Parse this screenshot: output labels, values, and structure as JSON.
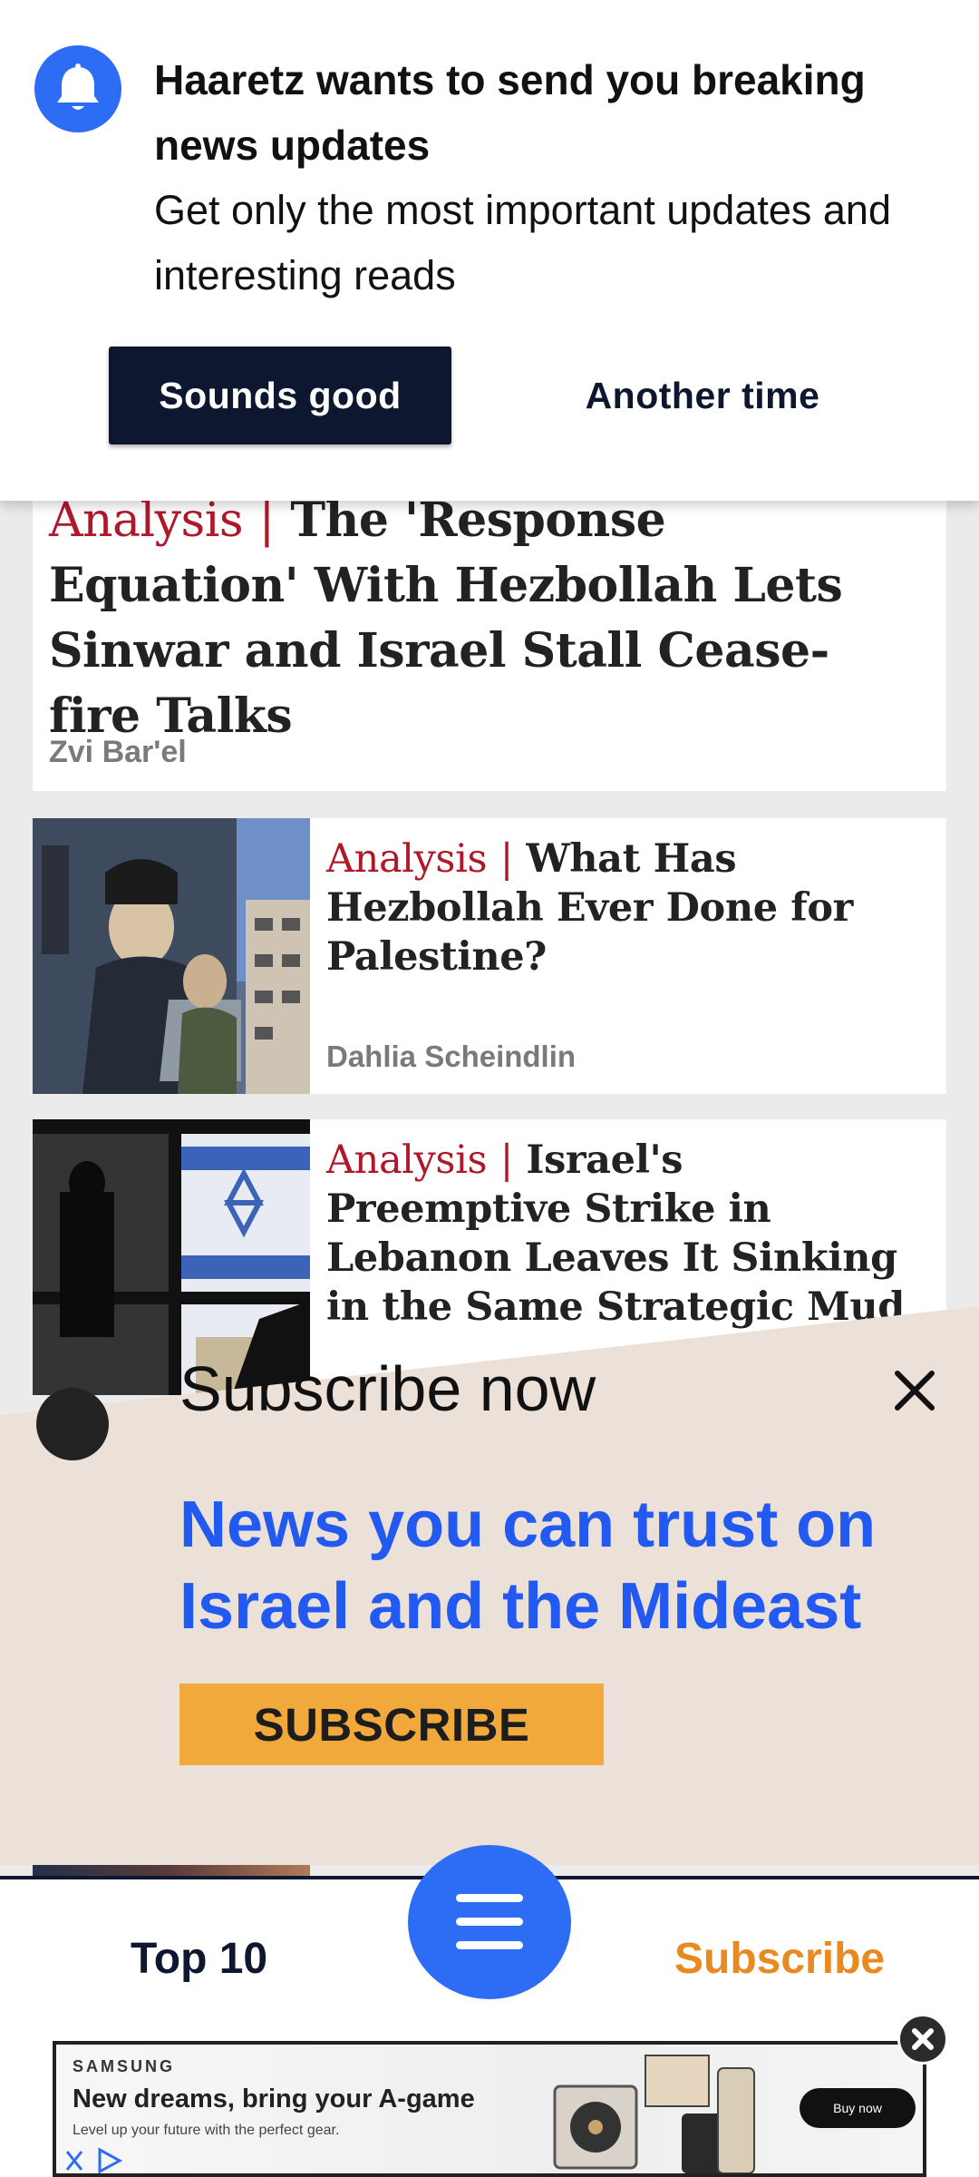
{
  "notification_prompt": {
    "title": "Haaretz wants to send you breaking news updates",
    "body": "Get only the most important updates and interesting reads",
    "accept_label": "Sounds good",
    "dismiss_label": "Another time",
    "icon": "bell-icon",
    "accent_color": "#2d6cf4"
  },
  "feed": {
    "articles": [
      {
        "kicker": "Analysis",
        "separator": "|",
        "title": "The 'Response Equation' With Hezbollah Lets Sinwar and Israel Stall Cease-fire Talks",
        "author": "Zvi Bar'el"
      },
      {
        "kicker": "Analysis",
        "separator": "|",
        "title": "What Has Hezbollah Ever Done for Palestine?",
        "author": "Dahlia Scheindlin"
      },
      {
        "kicker": "Analysis",
        "separator": "|",
        "title": "Israel's Preemptive Strike in Lebanon Leaves It Sinking in the Same Strategic Mud",
        "author": ""
      }
    ],
    "kicker_color": "#b0182a"
  },
  "subscribe_panel": {
    "heading": "Subscribe now",
    "tagline": "News you can trust on Israel and the Mideast",
    "button_label": "SUBSCRIBE",
    "background_color": "#ece1d8",
    "tagline_color": "#2259f0",
    "button_color": "#f2a93b"
  },
  "bottom_nav": {
    "left_label": "Top 10",
    "right_label": "Subscribe",
    "menu_icon": "hamburger-icon"
  },
  "ad": {
    "brand": "SAMSUNG",
    "headline": "New dreams, bring your A-game",
    "subline": "Level up your future with the perfect gear.",
    "cta": "Buy now"
  }
}
